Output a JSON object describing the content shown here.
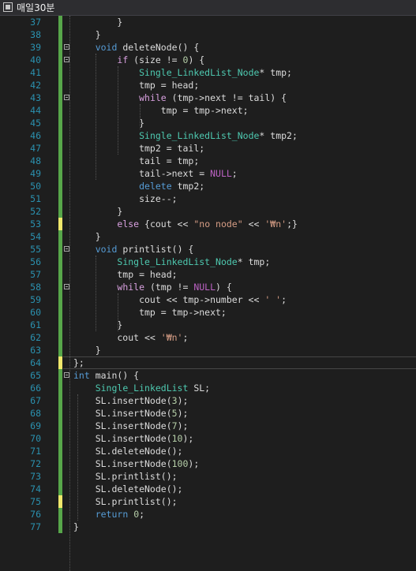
{
  "window": {
    "title": "매일30분"
  },
  "lines": [
    {
      "n": "37",
      "mark": "saved",
      "fold": false,
      "tokens": [
        [
          "p",
          "        }"
        ]
      ]
    },
    {
      "n": "38",
      "mark": "saved",
      "fold": false,
      "tokens": [
        [
          "p",
          "    }"
        ]
      ]
    },
    {
      "n": "39",
      "mark": "saved",
      "fold": true,
      "tokens": [
        [
          "p",
          "    "
        ],
        [
          "kw",
          "void"
        ],
        [
          "p",
          " deleteNode() {"
        ]
      ]
    },
    {
      "n": "40",
      "mark": "saved",
      "fold": true,
      "tokens": [
        [
          "p",
          "        "
        ],
        [
          "kw2",
          "if"
        ],
        [
          "p",
          " (size != "
        ],
        [
          "nu",
          "0"
        ],
        [
          "p",
          ") {"
        ]
      ]
    },
    {
      "n": "41",
      "mark": "saved",
      "fold": false,
      "tokens": [
        [
          "p",
          "            "
        ],
        [
          "ty",
          "Single_LinkedList_Node"
        ],
        [
          "p",
          "* tmp;"
        ]
      ]
    },
    {
      "n": "42",
      "mark": "saved",
      "fold": false,
      "tokens": [
        [
          "p",
          "            tmp = head;"
        ]
      ]
    },
    {
      "n": "43",
      "mark": "saved",
      "fold": true,
      "tokens": [
        [
          "p",
          "            "
        ],
        [
          "kw2",
          "while"
        ],
        [
          "p",
          " (tmp->next != tail) {"
        ]
      ]
    },
    {
      "n": "44",
      "mark": "saved",
      "fold": false,
      "tokens": [
        [
          "p",
          "                tmp = tmp->next;"
        ]
      ]
    },
    {
      "n": "45",
      "mark": "saved",
      "fold": false,
      "tokens": [
        [
          "p",
          "            }"
        ]
      ]
    },
    {
      "n": "46",
      "mark": "saved",
      "fold": false,
      "tokens": [
        [
          "p",
          "            "
        ],
        [
          "ty",
          "Single_LinkedList_Node"
        ],
        [
          "p",
          "* tmp2;"
        ]
      ]
    },
    {
      "n": "47",
      "mark": "saved",
      "fold": false,
      "tokens": [
        [
          "p",
          "            tmp2 = tail;"
        ]
      ]
    },
    {
      "n": "48",
      "mark": "saved",
      "fold": false,
      "tokens": [
        [
          "p",
          "            tail = tmp;"
        ]
      ]
    },
    {
      "n": "49",
      "mark": "saved",
      "fold": false,
      "tokens": [
        [
          "p",
          "            tail->next = "
        ],
        [
          "mac",
          "NULL"
        ],
        [
          "p",
          ";"
        ]
      ]
    },
    {
      "n": "50",
      "mark": "saved",
      "fold": false,
      "tokens": [
        [
          "p",
          "            "
        ],
        [
          "kw",
          "delete"
        ],
        [
          "p",
          " tmp2;"
        ]
      ]
    },
    {
      "n": "51",
      "mark": "saved",
      "fold": false,
      "tokens": [
        [
          "p",
          "            size--;"
        ]
      ]
    },
    {
      "n": "52",
      "mark": "saved",
      "fold": false,
      "tokens": [
        [
          "p",
          "        }"
        ]
      ]
    },
    {
      "n": "53",
      "mark": "unsaved",
      "fold": false,
      "tokens": [
        [
          "p",
          "        "
        ],
        [
          "kw2",
          "else"
        ],
        [
          "p",
          " {cout << "
        ],
        [
          "st",
          "\"no node\""
        ],
        [
          "p",
          " << "
        ],
        [
          "st",
          "'₩n'"
        ],
        [
          "p",
          ";}"
        ]
      ]
    },
    {
      "n": "54",
      "mark": "saved",
      "fold": false,
      "tokens": [
        [
          "p",
          "    }"
        ]
      ]
    },
    {
      "n": "55",
      "mark": "saved",
      "fold": true,
      "tokens": [
        [
          "p",
          "    "
        ],
        [
          "kw",
          "void"
        ],
        [
          "p",
          " printlist() {"
        ]
      ]
    },
    {
      "n": "56",
      "mark": "saved",
      "fold": false,
      "tokens": [
        [
          "p",
          "        "
        ],
        [
          "ty",
          "Single_LinkedList_Node"
        ],
        [
          "p",
          "* tmp;"
        ]
      ]
    },
    {
      "n": "57",
      "mark": "saved",
      "fold": false,
      "tokens": [
        [
          "p",
          "        tmp = head;"
        ]
      ]
    },
    {
      "n": "58",
      "mark": "saved",
      "fold": true,
      "tokens": [
        [
          "p",
          "        "
        ],
        [
          "kw2",
          "while"
        ],
        [
          "p",
          " (tmp != "
        ],
        [
          "mac",
          "NULL"
        ],
        [
          "p",
          ") {"
        ]
      ]
    },
    {
      "n": "59",
      "mark": "saved",
      "fold": false,
      "tokens": [
        [
          "p",
          "            cout << tmp->number << "
        ],
        [
          "st",
          "' '"
        ],
        [
          "p",
          ";"
        ]
      ]
    },
    {
      "n": "60",
      "mark": "saved",
      "fold": false,
      "tokens": [
        [
          "p",
          "            tmp = tmp->next;"
        ]
      ]
    },
    {
      "n": "61",
      "mark": "saved",
      "fold": false,
      "tokens": [
        [
          "p",
          "        }"
        ]
      ]
    },
    {
      "n": "62",
      "mark": "saved",
      "fold": false,
      "tokens": [
        [
          "p",
          "        cout << "
        ],
        [
          "st",
          "'₩n'"
        ],
        [
          "p",
          ";"
        ]
      ]
    },
    {
      "n": "63",
      "mark": "saved",
      "fold": false,
      "tokens": [
        [
          "p",
          "    }"
        ]
      ]
    },
    {
      "n": "64",
      "mark": "unsaved",
      "fold": false,
      "tokens": [
        [
          "p",
          "};"
        ]
      ]
    },
    {
      "n": "65",
      "mark": "saved",
      "fold": true,
      "tokens": [
        [
          "kw",
          "int"
        ],
        [
          "p",
          " main() {"
        ]
      ]
    },
    {
      "n": "66",
      "mark": "saved",
      "fold": false,
      "tokens": [
        [
          "p",
          "    "
        ],
        [
          "ty",
          "Single_LinkedList"
        ],
        [
          "p",
          " SL;"
        ]
      ]
    },
    {
      "n": "67",
      "mark": "saved",
      "fold": false,
      "tokens": [
        [
          "p",
          "    SL.insertNode("
        ],
        [
          "nu",
          "3"
        ],
        [
          "p",
          ");"
        ]
      ]
    },
    {
      "n": "68",
      "mark": "saved",
      "fold": false,
      "tokens": [
        [
          "p",
          "    SL.insertNode("
        ],
        [
          "nu",
          "5"
        ],
        [
          "p",
          ");"
        ]
      ]
    },
    {
      "n": "69",
      "mark": "saved",
      "fold": false,
      "tokens": [
        [
          "p",
          "    SL.insertNode("
        ],
        [
          "nu",
          "7"
        ],
        [
          "p",
          ");"
        ]
      ]
    },
    {
      "n": "70",
      "mark": "saved",
      "fold": false,
      "tokens": [
        [
          "p",
          "    SL.insertNode("
        ],
        [
          "nu",
          "10"
        ],
        [
          "p",
          ");"
        ]
      ]
    },
    {
      "n": "71",
      "mark": "saved",
      "fold": false,
      "tokens": [
        [
          "p",
          "    SL.deleteNode();"
        ]
      ]
    },
    {
      "n": "72",
      "mark": "saved",
      "fold": false,
      "tokens": [
        [
          "p",
          "    SL.insertNode("
        ],
        [
          "nu",
          "100"
        ],
        [
          "p",
          ");"
        ]
      ]
    },
    {
      "n": "73",
      "mark": "saved",
      "fold": false,
      "tokens": [
        [
          "p",
          "    SL.printlist();"
        ]
      ]
    },
    {
      "n": "74",
      "mark": "saved",
      "fold": false,
      "tokens": [
        [
          "p",
          "    SL.deleteNode();"
        ]
      ]
    },
    {
      "n": "75",
      "mark": "unsaved",
      "fold": false,
      "tokens": [
        [
          "p",
          "    SL.printlist();"
        ]
      ]
    },
    {
      "n": "76",
      "mark": "saved",
      "fold": false,
      "tokens": [
        [
          "p",
          "    "
        ],
        [
          "kw",
          "return"
        ],
        [
          "p",
          " "
        ],
        [
          "nu",
          "0"
        ],
        [
          "p",
          ";"
        ]
      ]
    },
    {
      "n": "77",
      "mark": "saved",
      "fold": false,
      "tokens": [
        [
          "p",
          "}"
        ]
      ]
    }
  ],
  "current_line": "64"
}
